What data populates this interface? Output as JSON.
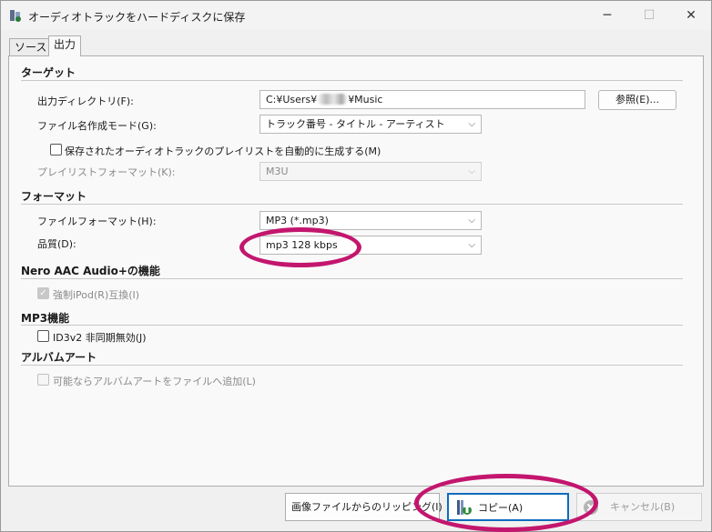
{
  "window": {
    "title": "オーディオトラックをハードディスクに保存",
    "minimize_glyph": "─",
    "maximize_glyph": "☐",
    "close_glyph": "✕"
  },
  "tabs": [
    {
      "label": "ソース",
      "active": false
    },
    {
      "label": "出力",
      "active": true
    }
  ],
  "target": {
    "section_title": "ターゲット",
    "output_dir_label": "出力ディレクトリ(F):",
    "output_dir_prefix": "C:¥Users¥",
    "output_dir_suffix": "¥Music",
    "browse_button": "参照(E)...",
    "filename_mode_label": "ファイル名作成モード(G):",
    "filename_mode_value": "トラック番号 - タイトル - アーティスト",
    "playlist_checkbox_label": "保存されたオーディオトラックのプレイリストを自動的に生成する(M)",
    "playlist_format_label": "プレイリストフォーマット(K):",
    "playlist_format_value": "M3U"
  },
  "format": {
    "section_title": "フォーマット",
    "file_format_label": "ファイルフォーマット(H):",
    "file_format_value": "MP3 (*.mp3)",
    "quality_label": "品質(D):",
    "quality_value": "mp3 128 kbps"
  },
  "nero_aac": {
    "section_title": "Nero AAC Audio+の機能",
    "ipod_checkbox_label": "強制iPod(R)互換(I)"
  },
  "mp3": {
    "section_title": "MP3機能",
    "id3_checkbox_label": "ID3v2 非同期無効(J)"
  },
  "album_art": {
    "section_title": "アルバムアート",
    "add_art_checkbox_label": "可能ならアルバムアートをファイルへ追加(L)"
  },
  "footer": {
    "rip_from_image_button": "画像ファイルからのリッピング(I)",
    "copy_button": "コピー(A)",
    "cancel_button": "キャンセル(B)"
  },
  "colors": {
    "highlight_ellipse": "#c3166e",
    "primary_border": "#0f6cbd"
  }
}
